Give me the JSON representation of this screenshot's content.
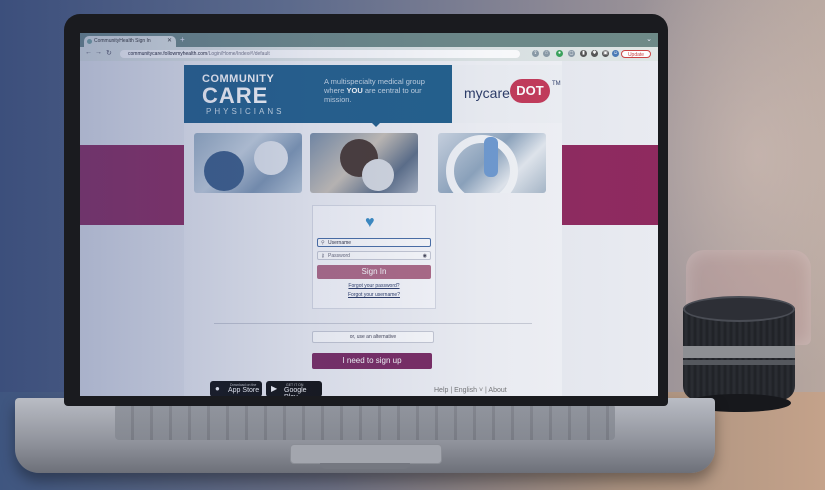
{
  "browser": {
    "tab_title": "CommunityHealth Sign In",
    "new_tab_symbol": "+",
    "url_host": "communitycare.followmyhealth.com",
    "url_path": "/Login/Home/Index#!/default",
    "update_label": "Update"
  },
  "banner": {
    "logo_line1": "COMMUNITY",
    "logo_line2": "CARE",
    "logo_line3": "PHYSICIANS",
    "tagline_part1": "A multispecialty medical group where ",
    "tagline_bold": "YOU",
    "tagline_part2": " are central to our mission.",
    "brand_text": "mycare",
    "brand_dot": "DOT",
    "brand_tm": "TM"
  },
  "login": {
    "username_placeholder": "Username",
    "password_placeholder": "Password",
    "signin_label": "Sign In",
    "forgot_password": "Forgot your password?",
    "forgot_username": "Forgot your username?",
    "alt_label": "or, use an alternative",
    "signup_label": "I need to sign up"
  },
  "stores": {
    "apple_small": "Download on the",
    "apple_big": "App Store",
    "google_small": "GET IT ON",
    "google_big": "Google Play"
  },
  "footer": {
    "links": "Help | English ˅ | About"
  },
  "colors": {
    "banner_blue": "#22608c",
    "brand_magenta": "#c43a59",
    "signup_purple": "#7b2a62",
    "side_band": "#8f2a5f"
  }
}
